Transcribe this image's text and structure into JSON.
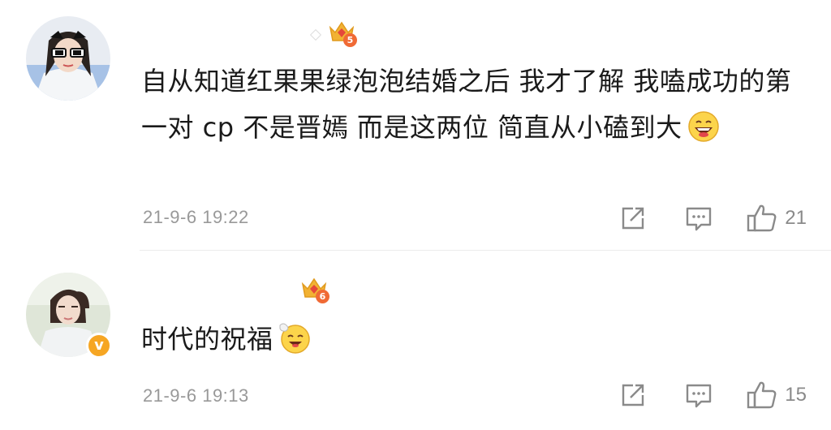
{
  "comments": [
    {
      "text": "自从知道红果果绿泡泡结婚之后 我才了解 我嗑成功的第一对 cp 不是晋嫣 而是这两位 简直从小磕到大",
      "emoji": "grinning-face",
      "level": "5",
      "time": "21-9-6 19:22",
      "likes": "21",
      "verified": false
    },
    {
      "text": "时代的祝福",
      "emoji": "blessed-face",
      "level": "6",
      "time": "21-9-6 19:13",
      "likes": "15",
      "verified": true,
      "verified_mark": "v"
    }
  ],
  "colors": {
    "meta_gray": "#999999",
    "icon_gray": "#8a8a8a",
    "crown_gold": "#f2b233",
    "level_orange": "#f06a35",
    "verified_orange": "#f6a623"
  },
  "icons": [
    "share-icon",
    "comment-icon",
    "like-icon",
    "level-crown-icon"
  ]
}
